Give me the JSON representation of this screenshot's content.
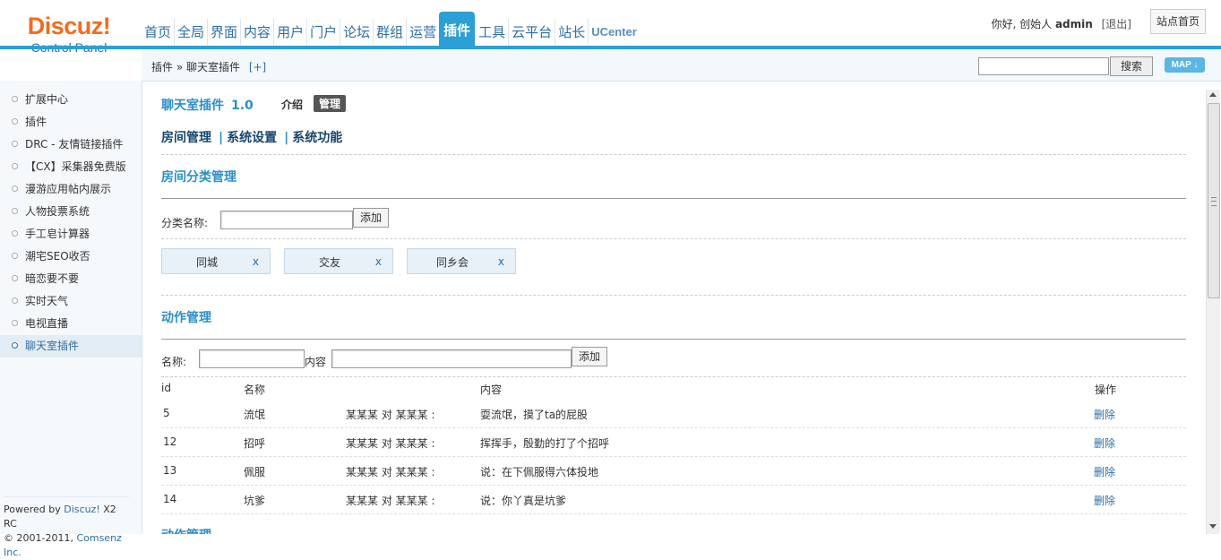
{
  "logo": {
    "brand": "Discuz!",
    "sub": "Control Panel"
  },
  "nav": {
    "items": [
      "首页",
      "全局",
      "界面",
      "内容",
      "用户",
      "门户",
      "论坛",
      "群组",
      "运营",
      "插件",
      "工具",
      "云平台",
      "站长",
      "UCenter"
    ],
    "active": "插件"
  },
  "user": {
    "greeting": "你好, 创始人",
    "name": "admin",
    "logout": "[退出]",
    "site_home": "站点首页"
  },
  "breadcrumb": {
    "path": "插件 » 聊天室插件",
    "add": "[+]"
  },
  "search": {
    "value": "",
    "button": "搜索",
    "map": "MAP"
  },
  "sidebar": {
    "items": [
      "扩展中心",
      "插件",
      "DRC - 友情链接插件",
      "【CX】采集器免费版",
      "漫游应用帖内展示",
      "人物投票系统",
      "手工皂计算器",
      "潮宅SEO收否",
      "暗恋要不要",
      "实时天气",
      "电视直播",
      "聊天室插件"
    ],
    "active": "聊天室插件"
  },
  "footer": {
    "line1_prefix": "Powered by ",
    "line1_brand": "Discuz!",
    "line1_ver": " X2 RC",
    "line2_prefix": "© 2001-2011, ",
    "line2_company": "Comsenz Inc."
  },
  "plugin": {
    "name": "聊天室插件",
    "version": "1.0",
    "tab_intro": "介绍",
    "tab_manage": "管理"
  },
  "subnav": [
    "房间管理",
    "系统设置",
    "系统功能"
  ],
  "category": {
    "title": "房间分类管理",
    "label": "分类名称:",
    "value": "",
    "add": "添加",
    "tags": [
      {
        "name": "同城",
        "x": "x"
      },
      {
        "name": "交友",
        "x": "x"
      },
      {
        "name": "同乡会",
        "x": "x"
      }
    ]
  },
  "action": {
    "title": "动作管理",
    "name_label": "名称:",
    "content_label": "内容",
    "add": "添加",
    "headers": {
      "id": "id",
      "name": "名称",
      "content": "内容",
      "op": "操作"
    },
    "rows": [
      {
        "id": "5",
        "name": "流氓",
        "pattern": "某某某 对 某某某 :",
        "content": "耍流氓，摸了ta的屁股",
        "op": "删除"
      },
      {
        "id": "12",
        "name": "招呼",
        "pattern": "某某某 对 某某某 :",
        "content": "挥挥手，殷勤的打了个招呼",
        "op": "删除"
      },
      {
        "id": "13",
        "name": "佩服",
        "pattern": "某某某 对 某某某 :",
        "content": "说：在下佩服得六体投地",
        "op": "删除"
      },
      {
        "id": "14",
        "name": "坑爹",
        "pattern": "某某某 对 某某某 :",
        "content": "说：你丫真是坑爹",
        "op": "删除"
      }
    ]
  },
  "partial_next": "动作管理",
  "colors": {
    "accent": "#2b9fd6",
    "logo": "#f26c1d",
    "link": "#2c6fa8"
  }
}
